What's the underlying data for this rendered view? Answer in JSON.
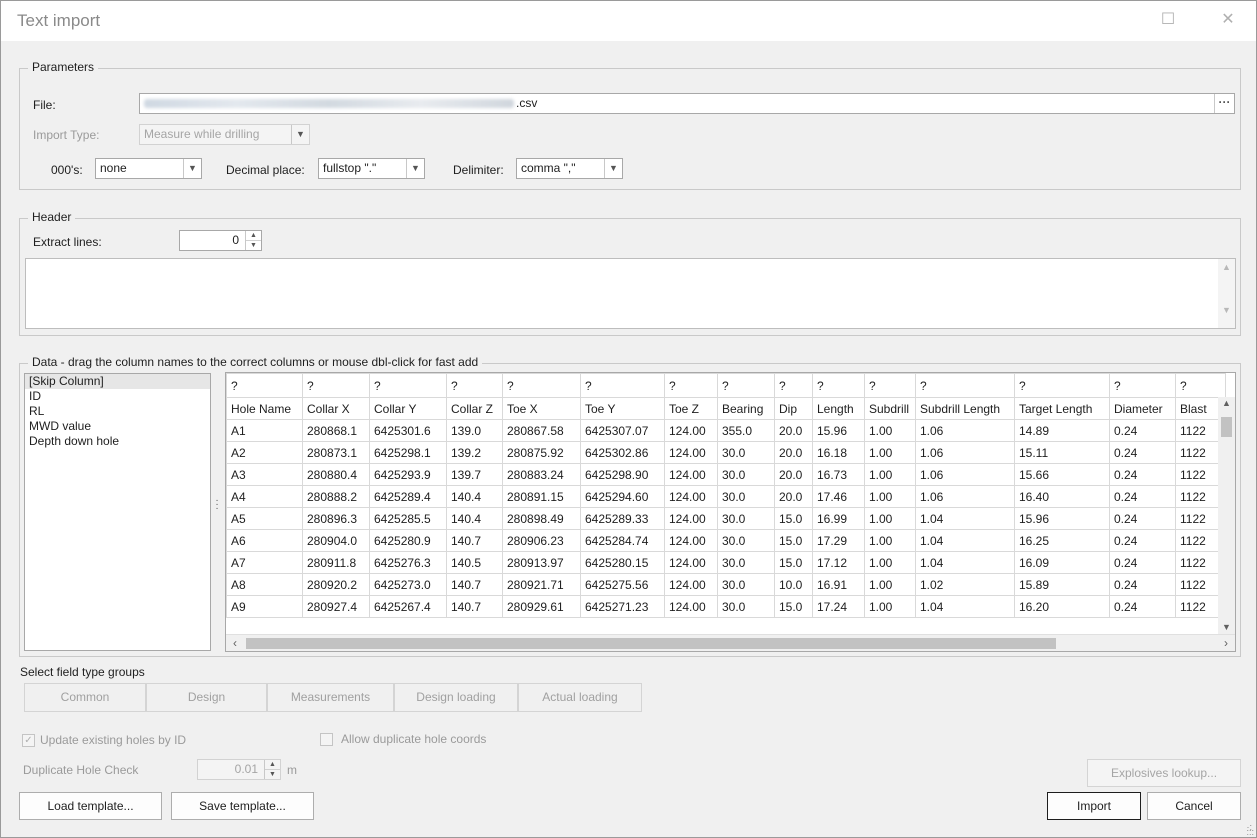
{
  "window": {
    "title": "Text import",
    "maximize_glyph": "☐",
    "close_glyph": "✕"
  },
  "parameters": {
    "group_title": "Parameters",
    "file_label": "File:",
    "file_value": ".csv",
    "browse_label": "···",
    "import_type_label": "Import Type:",
    "import_type_value": "Measure while drilling",
    "thousands_label": "000's:",
    "thousands_value": "none",
    "decimal_label": "Decimal place:",
    "decimal_value": "fullstop \".\"",
    "delimiter_label": "Delimiter:",
    "delimiter_value": "comma \",\""
  },
  "header": {
    "group_title": "Header",
    "extract_label": "Extract lines:",
    "extract_value": "0"
  },
  "data": {
    "group_title": "Data - drag the column names to the correct columns or mouse dbl-click for fast add",
    "field_list": [
      "[Skip Column]",
      "ID",
      "RL",
      "MWD value",
      "Depth down hole"
    ],
    "column_types": [
      "?",
      "?",
      "?",
      "?",
      "?",
      "?",
      "?",
      "?",
      "?",
      "?",
      "?",
      "?",
      "?",
      "?",
      "?"
    ],
    "columns": [
      "Hole Name",
      "Collar X",
      "Collar Y",
      "Collar Z",
      "Toe X",
      "Toe Y",
      "Toe Z",
      "Bearing",
      "Dip",
      "Length",
      "Subdrill",
      "Subdrill Length",
      "Target Length",
      "Diameter",
      "Blast"
    ],
    "rows": [
      [
        "A1",
        "280868.1",
        "6425301.6",
        "139.0",
        "280867.58",
        "6425307.07",
        "124.00",
        "355.0",
        "20.0",
        "15.96",
        "1.00",
        "1.06",
        "14.89",
        "0.24",
        "1122"
      ],
      [
        "A2",
        "280873.1",
        "6425298.1",
        "139.2",
        "280875.92",
        "6425302.86",
        "124.00",
        "30.0",
        "20.0",
        "16.18",
        "1.00",
        "1.06",
        "15.11",
        "0.24",
        "1122"
      ],
      [
        "A3",
        "280880.4",
        "6425293.9",
        "139.7",
        "280883.24",
        "6425298.90",
        "124.00",
        "30.0",
        "20.0",
        "16.73",
        "1.00",
        "1.06",
        "15.66",
        "0.24",
        "1122"
      ],
      [
        "A4",
        "280888.2",
        "6425289.4",
        "140.4",
        "280891.15",
        "6425294.60",
        "124.00",
        "30.0",
        "20.0",
        "17.46",
        "1.00",
        "1.06",
        "16.40",
        "0.24",
        "1122"
      ],
      [
        "A5",
        "280896.3",
        "6425285.5",
        "140.4",
        "280898.49",
        "6425289.33",
        "124.00",
        "30.0",
        "15.0",
        "16.99",
        "1.00",
        "1.04",
        "15.96",
        "0.24",
        "1122"
      ],
      [
        "A6",
        "280904.0",
        "6425280.9",
        "140.7",
        "280906.23",
        "6425284.74",
        "124.00",
        "30.0",
        "15.0",
        "17.29",
        "1.00",
        "1.04",
        "16.25",
        "0.24",
        "1122"
      ],
      [
        "A7",
        "280911.8",
        "6425276.3",
        "140.5",
        "280913.97",
        "6425280.15",
        "124.00",
        "30.0",
        "15.0",
        "17.12",
        "1.00",
        "1.04",
        "16.09",
        "0.24",
        "1122"
      ],
      [
        "A8",
        "280920.2",
        "6425273.0",
        "140.7",
        "280921.71",
        "6425275.56",
        "124.00",
        "30.0",
        "10.0",
        "16.91",
        "1.00",
        "1.02",
        "15.89",
        "0.24",
        "1122"
      ],
      [
        "A9",
        "280927.4",
        "6425267.4",
        "140.7",
        "280929.61",
        "6425271.23",
        "124.00",
        "30.0",
        "15.0",
        "17.24",
        "1.00",
        "1.04",
        "16.20",
        "0.24",
        "1122"
      ]
    ]
  },
  "field_groups": {
    "label": "Select field type groups",
    "buttons": [
      "Common",
      "Design",
      "Measurements",
      "Design loading",
      "Actual loading"
    ]
  },
  "options": {
    "update_existing_label": "Update existing holes by ID",
    "update_existing_checked": true,
    "allow_duplicate_label": "Allow duplicate hole coords",
    "allow_duplicate_checked": false,
    "dup_check_label": "Duplicate Hole Check",
    "dup_check_value": "0.01",
    "dup_check_unit": "m"
  },
  "buttons": {
    "explosives_lookup": "Explosives lookup...",
    "load_template": "Load template...",
    "save_template": "Save template...",
    "import": "Import",
    "cancel": "Cancel"
  }
}
